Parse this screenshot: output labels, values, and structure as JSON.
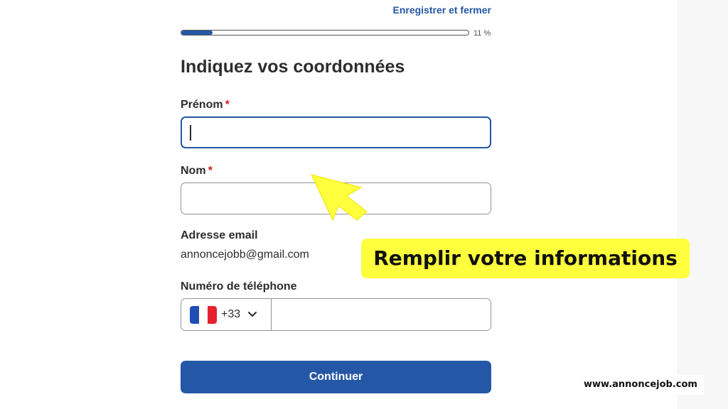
{
  "header": {
    "save_close_label": "Enregistrer et fermer",
    "progress_text": "11 %",
    "progress_value": 0.11
  },
  "form": {
    "title": "Indiquez vos coordonnées",
    "first_name": {
      "label": "Prénom",
      "required_mark": "*",
      "value": ""
    },
    "last_name": {
      "label": "Nom",
      "required_mark": "*",
      "value": ""
    },
    "email": {
      "label": "Adresse email",
      "value": "annoncejobb@gmail.com"
    },
    "phone": {
      "label": "Numéro de téléphone",
      "country_code": "+33",
      "flag_icon": "flag-france-icon",
      "value": ""
    },
    "continue_label": "Continuer"
  },
  "overlay": {
    "callout_text": "Remplir votre informations",
    "callout_color": "#ffff3d",
    "arrow_icon": "pointer-arrow-icon",
    "watermark": "www.annoncejob.com"
  },
  "colors": {
    "accent": "#2557a7",
    "required": "#c91c1c",
    "text": "#2d2d2d",
    "border": "#949494"
  }
}
